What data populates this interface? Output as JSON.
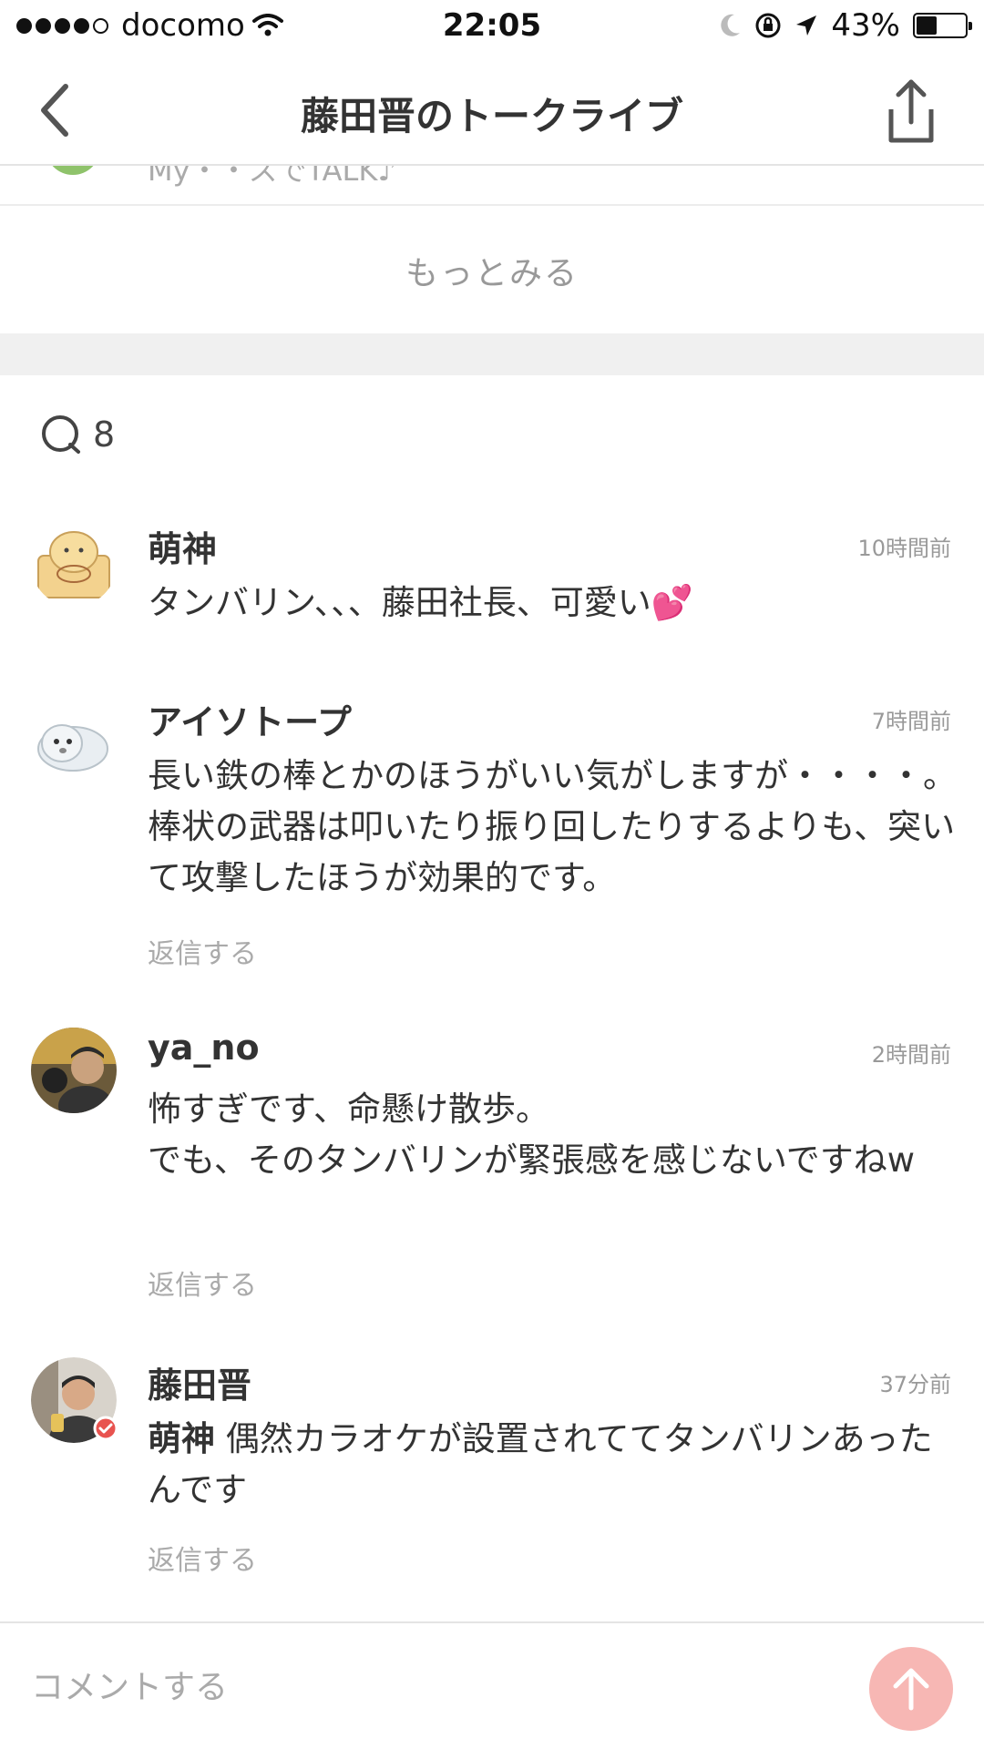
{
  "status_bar": {
    "carrier": "docomo",
    "time": "22:05",
    "battery_percent": "43%",
    "battery_level": 0.43,
    "icons": [
      "signal-dots",
      "wifi-icon",
      "moon-icon",
      "rotation-lock-icon",
      "location-arrow-icon",
      "battery-icon"
    ]
  },
  "nav": {
    "title": "藤田晋のトークライブ",
    "back_icon": "chevron-left-icon",
    "share_icon": "share-icon"
  },
  "peek": {
    "text": "My・・スでTALK♪"
  },
  "more_label": "もっとみる",
  "comment_count": "8",
  "comments": [
    {
      "name": "萌神",
      "time": "10時間前",
      "text": "タンバリン、、、藤田社長、可愛い💕",
      "reply": ""
    },
    {
      "name": "アイソトープ",
      "time": "7時間前",
      "text": "長い鉄の棒とかのほうがいい気がしますが・・・・。棒状の武器は叩いたり振り回したりするよりも、突いて攻撃したほうが効果的です。",
      "reply": "返信する"
    },
    {
      "name": "ya_no",
      "time": "2時間前",
      "line1": "怖すぎです、命懸け散歩。",
      "line2": "でも、そのタンバリンが緊張感を感じないですねw",
      "reply": "返信する"
    },
    {
      "name": "藤田晋",
      "time": "37分前",
      "mention": "萌神",
      "text": " 偶然カラオケが設置されててタンバリンあったんです",
      "reply": "返信する"
    }
  ],
  "input": {
    "placeholder": "コメントする"
  },
  "colors": {
    "send_button": "#f7b7b4",
    "separator": "#f0f0f0",
    "verified_badge": "#e8534f"
  }
}
